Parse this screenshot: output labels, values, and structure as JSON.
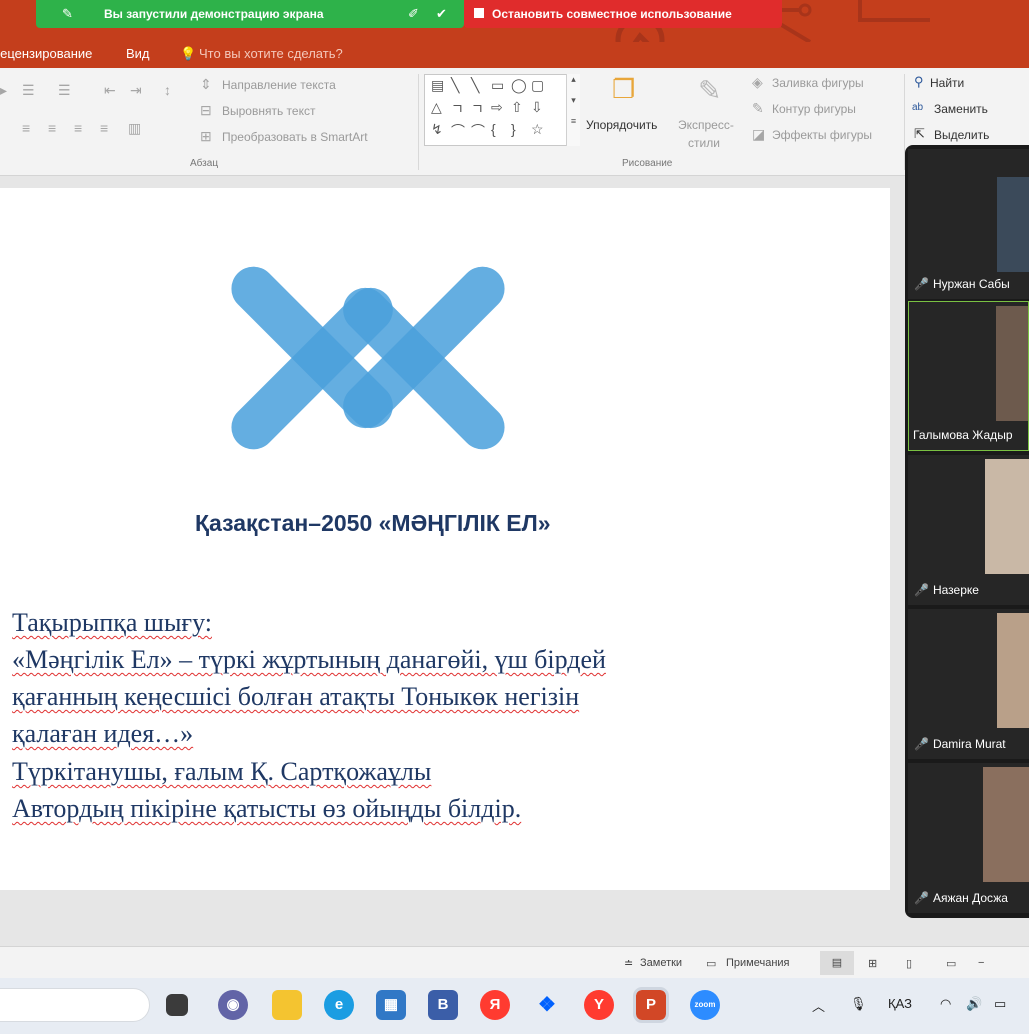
{
  "share_bar": {
    "status_text": "Вы запустили демонстрацию экрана",
    "stop_label": "Остановить совместное использование"
  },
  "menu": {
    "items": [
      "Рецензирование",
      "Вид"
    ],
    "tell_me": "Что вы хотите сделать?"
  },
  "ribbon": {
    "paragraph": {
      "text_direction": "Направление текста",
      "align_text": "Выровнять текст",
      "convert_smartart": "Преобразовать в SmartArt",
      "group_label": "Абзац"
    },
    "drawing": {
      "arrange": "Упорядочить",
      "quick_styles_1": "Экспресс-",
      "quick_styles_2": "стили",
      "shape_fill": "Заливка фигуры",
      "shape_outline": "Контур фигуры",
      "shape_effects": "Эффекты фигуры",
      "group_label": "Рисование"
    },
    "editing": {
      "find": "Найти",
      "replace": "Заменить",
      "select": "Выделить"
    }
  },
  "slide": {
    "title": "Қазақстан–2050 «МӘҢГІЛІК ЕЛ»",
    "lines": [
      "Тақырыпқа шығу:",
      "«Мәңгілік Ел» – түркі жұртының данагөйі, үш бірдей",
      "қағанның кеңесшісі болған атақты Тоныкөк негізін",
      "қалаған идея…»",
      "Түркітанушы, ғалым Қ. Сартқожаұлы",
      "Автордың пікіріне қатысты өз ойыңды білдір."
    ]
  },
  "status_bar": {
    "notes": "Заметки",
    "comments": "Примечания"
  },
  "participants": [
    {
      "name": "Нуржан Сабы",
      "muted": true
    },
    {
      "name": "Галымова Жадыр",
      "muted": false
    },
    {
      "name": "Назерке",
      "muted": true
    },
    {
      "name": "Damira Murat",
      "muted": true
    },
    {
      "name": "Аяжан Досжа",
      "muted": true
    }
  ],
  "taskbar": {
    "language": "ҚАЗ"
  },
  "colors": {
    "powerpoint_accent": "#c43e1c",
    "share_green": "#2eb24a",
    "share_red": "#e02c2c",
    "slide_text": "#1f3864",
    "logo_blue": "#4a9fdc"
  }
}
